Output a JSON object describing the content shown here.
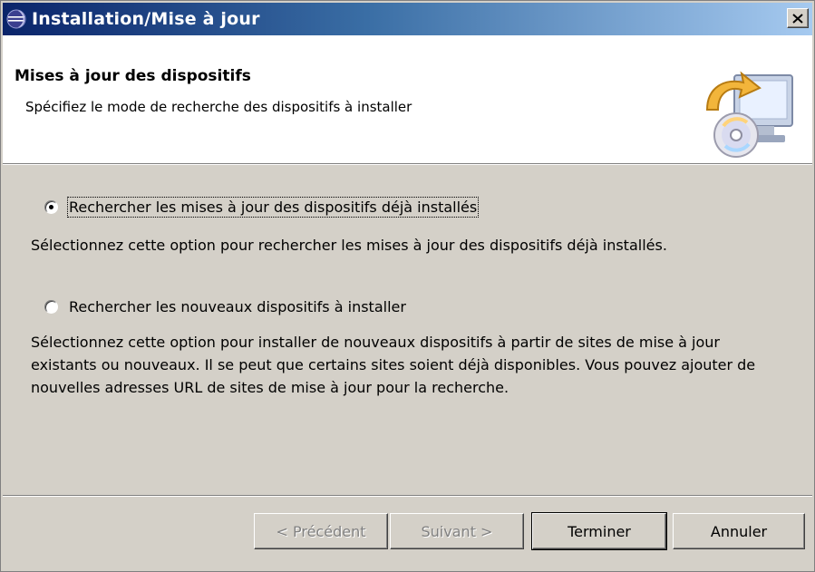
{
  "window": {
    "title": "Installation/Mise à jour",
    "close_glyph": "✕"
  },
  "header": {
    "title": "Mises à jour des dispositifs",
    "description": "Spécifiez le mode de recherche des dispositifs à installer",
    "icon": "update-wizard-icon"
  },
  "options": [
    {
      "label": "Rechercher les mises à jour des dispositifs déjà installés",
      "selected": true,
      "description": "Sélectionnez cette option pour rechercher les mises à jour des dispositifs déjà installés."
    },
    {
      "label": "Rechercher les nouveaux dispositifs à installer",
      "selected": false,
      "description": "Sélectionnez cette option pour installer de nouveaux dispositifs à partir de sites de mise à jour existants ou nouveaux. Il se peut que certains sites soient déjà disponibles. Vous pouvez ajouter de nouvelles adresses URL de sites de mise à jour pour la recherche."
    }
  ],
  "buttons": {
    "back": "< Précédent",
    "next": "Suivant >",
    "finish": "Terminer",
    "cancel": "Annuler"
  },
  "colors": {
    "titlebar_start": "#0a246a",
    "titlebar_end": "#a6caf0",
    "dialog_bg": "#d4d0c8",
    "header_bg": "#ffffff"
  }
}
